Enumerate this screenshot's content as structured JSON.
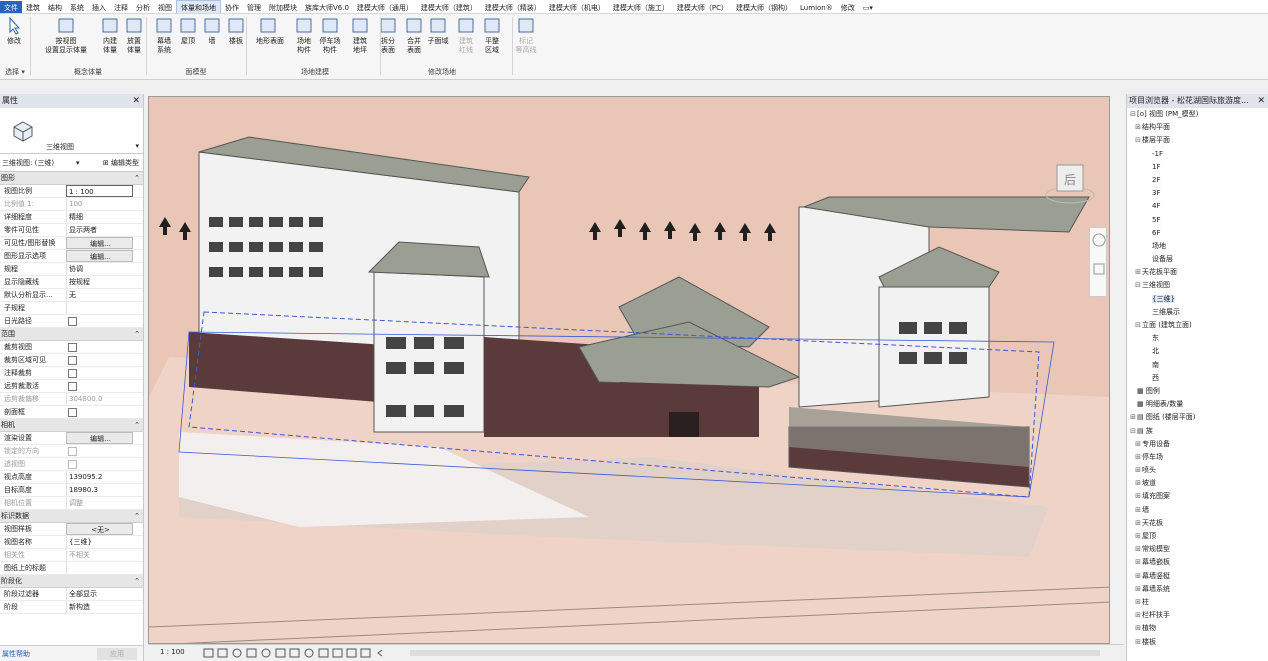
{
  "menu": [
    "文件",
    "建筑",
    "结构",
    "系统",
    "插入",
    "注释",
    "分析",
    "视图",
    "体量和场地",
    "协作",
    "管理",
    "附加模块",
    "族库大师V6.0",
    "建模大师（通用）",
    "建模大师（建筑）",
    "建模大师（精装）",
    "建模大师（机电）",
    "建模大师（施工）",
    "建模大师（PC）",
    "建模大师（钢构）",
    "Lumion®",
    "修改",
    "▭▾"
  ],
  "menu_active": 8,
  "ribbon": {
    "modify": "修改",
    "select": "选择 ▾",
    "btns": [
      "按视图\n设置显示体量",
      "内建\n体量",
      "放置\n体量",
      "幕墙\n系统",
      "屋顶",
      "墙",
      "楼板",
      "地形表面",
      "场地\n构件",
      "停车场\n构件",
      "建筑\n地坪",
      "拆分\n表面",
      "合并\n表面",
      "子面域",
      "建筑\n红线",
      "平整\n区域",
      "标记\n等高线"
    ],
    "groups": [
      "选择",
      "概念体量",
      "面模型",
      "场地建模",
      "修改场地"
    ]
  },
  "properties": {
    "title": "属性",
    "type_name": "三维视图",
    "instance": "三维视图: (三维)",
    "edit_type": "编辑类型",
    "sections": [
      {
        "name": "图形",
        "rows": [
          [
            "视图比例",
            "1 : 100",
            "box"
          ],
          [
            "比例值 1:",
            "100",
            "dim"
          ],
          [
            "详细程度",
            "精细",
            ""
          ],
          [
            "零件可见性",
            "显示两者",
            ""
          ],
          [
            "可见性/图形替换",
            "编辑...",
            "btn"
          ],
          [
            "图形显示选项",
            "编辑...",
            "btn"
          ],
          [
            "规程",
            "协调",
            ""
          ],
          [
            "显示隐藏线",
            "按规程",
            ""
          ],
          [
            "默认分析显示...",
            "无",
            ""
          ],
          [
            "子规程",
            "",
            ""
          ],
          [
            "日光路径",
            "",
            "chk"
          ]
        ]
      },
      {
        "name": "范围",
        "rows": [
          [
            "裁剪视图",
            "",
            "chk"
          ],
          [
            "裁剪区域可见",
            "",
            "chk"
          ],
          [
            "注释裁剪",
            "",
            "chk"
          ],
          [
            "远剪裁激活",
            "",
            "chk"
          ],
          [
            "远剪裁偏移",
            "304800.0",
            "dim"
          ],
          [
            "剖面框",
            "",
            "chk"
          ]
        ]
      },
      {
        "name": "相机",
        "rows": [
          [
            "渲染设置",
            "编辑...",
            "btn"
          ],
          [
            "锁定的方向",
            "",
            "chkdim"
          ],
          [
            "透视图",
            "",
            "chkdim"
          ],
          [
            "视点高度",
            "139095.2",
            ""
          ],
          [
            "目标高度",
            "18980.3",
            ""
          ],
          [
            "相机位置",
            "调整",
            "dim"
          ]
        ]
      },
      {
        "name": "标识数据",
        "rows": [
          [
            "视图样板",
            "<无>",
            "btn"
          ],
          [
            "视图名称",
            "{三维}",
            ""
          ],
          [
            "相关性",
            "不相关",
            "dim"
          ],
          [
            "图纸上的标题",
            "",
            ""
          ]
        ]
      },
      {
        "name": "阶段化",
        "rows": [
          [
            "阶段过滤器",
            "全部显示",
            ""
          ],
          [
            "阶段",
            "新构造",
            ""
          ]
        ]
      }
    ],
    "help": "属性帮助",
    "apply": "应用"
  },
  "status": {
    "scale": "1 : 100"
  },
  "browser": {
    "title": "项目浏览器 - 松花湖国际旅游度...",
    "nodes": [
      [
        "⊟",
        "[o] 视图 (PM_模型)",
        0
      ],
      [
        "⊞",
        "结构平面",
        1
      ],
      [
        "⊟",
        "楼层平面",
        1
      ],
      [
        "",
        "-1F",
        3
      ],
      [
        "",
        "1F",
        3
      ],
      [
        "",
        "2F",
        3
      ],
      [
        "",
        "3F",
        3
      ],
      [
        "",
        "4F",
        3
      ],
      [
        "",
        "5F",
        3
      ],
      [
        "",
        "6F",
        3
      ],
      [
        "",
        "场地",
        3
      ],
      [
        "",
        "设备层",
        3
      ],
      [
        "⊞",
        "天花板平面",
        1
      ],
      [
        "⊟",
        "三维视图",
        1
      ],
      [
        "",
        "{三维}",
        3,
        "sel"
      ],
      [
        "",
        "三维展示",
        3
      ],
      [
        "⊟",
        "立面 (建筑立面)",
        1
      ],
      [
        "",
        "东",
        3
      ],
      [
        "",
        "北",
        3
      ],
      [
        "",
        "南",
        3
      ],
      [
        "",
        "西",
        3
      ],
      [
        "",
        "▦ 图例",
        0
      ],
      [
        "",
        "▦ 明细表/数量",
        0
      ],
      [
        "⊞",
        "▤ 图纸 (楼层平面)",
        0
      ],
      [
        "⊟",
        "▤ 族",
        0
      ],
      [
        "⊞",
        "专用设备",
        1
      ],
      [
        "⊞",
        "停车场",
        1
      ],
      [
        "⊞",
        "喷头",
        1
      ],
      [
        "⊞",
        "坡道",
        1
      ],
      [
        "⊞",
        "填充图案",
        1
      ],
      [
        "⊞",
        "墙",
        1
      ],
      [
        "⊞",
        "天花板",
        1
      ],
      [
        "⊞",
        "屋顶",
        1
      ],
      [
        "⊞",
        "常规模型",
        1
      ],
      [
        "⊞",
        "幕墙嵌板",
        1
      ],
      [
        "⊞",
        "幕墙竖梃",
        1
      ],
      [
        "⊞",
        "幕墙系统",
        1
      ],
      [
        "⊞",
        "柱",
        1
      ],
      [
        "⊞",
        "栏杆扶手",
        1
      ],
      [
        "⊞",
        "植物",
        1
      ],
      [
        "⊞",
        "楼板",
        1
      ]
    ]
  },
  "viewcube": {
    "face": "后"
  },
  "colors": {
    "viewport_bg": "#e9c6b6",
    "roof": "#9b9e92",
    "brick": "#5a3a3a",
    "wall": "#f2f2f2",
    "accent": "#2a64b8"
  }
}
